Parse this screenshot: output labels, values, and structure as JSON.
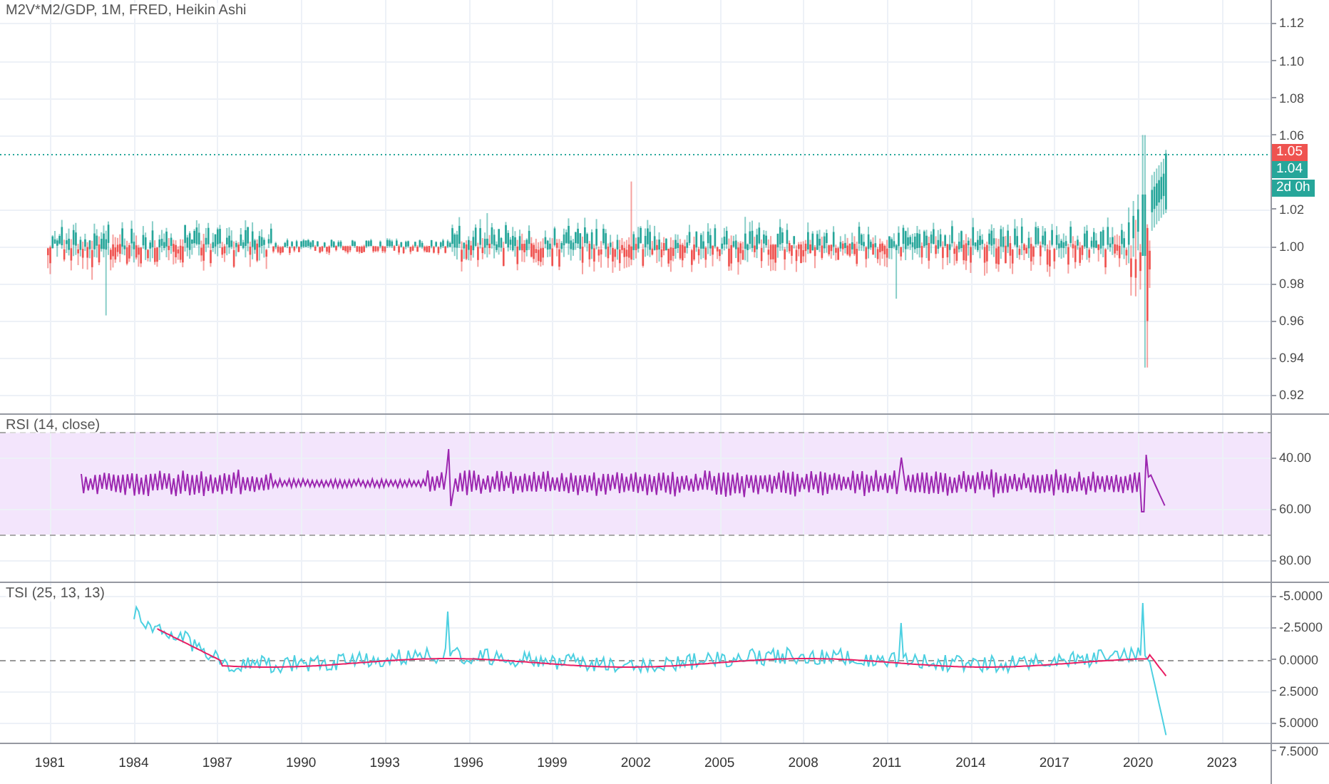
{
  "chart": {
    "title": "M2V*M2/GDP, 1M, FRED, Heikin Ashi",
    "price_axis": {
      "ticks": [
        "1.12",
        "1.10",
        "1.08",
        "1.06",
        "1.02",
        "1.00",
        "0.98",
        "0.96",
        "0.94",
        "0.92"
      ]
    },
    "price_labels": [
      {
        "text": "1.05",
        "color": "#ef5350"
      },
      {
        "text": "1.04",
        "color": "#26a69a"
      },
      {
        "text": "2d 0h",
        "color": "#26a69a"
      }
    ]
  },
  "rsi": {
    "title": "RSI (14, close)",
    "ticks": [
      "40.00",
      "60.00",
      "80.00"
    ]
  },
  "tsi": {
    "title": "TSI (25, 13, 13)",
    "ticks": [
      "-5.0000",
      "-2.5000",
      "0.0000",
      "2.5000",
      "5.0000",
      "7.5000"
    ]
  },
  "time_axis": {
    "labels": [
      "1981",
      "1984",
      "1987",
      "1990",
      "1993",
      "1996",
      "1999",
      "2002",
      "2005",
      "2008",
      "2011",
      "2014",
      "2017",
      "2020",
      "2023"
    ]
  }
}
